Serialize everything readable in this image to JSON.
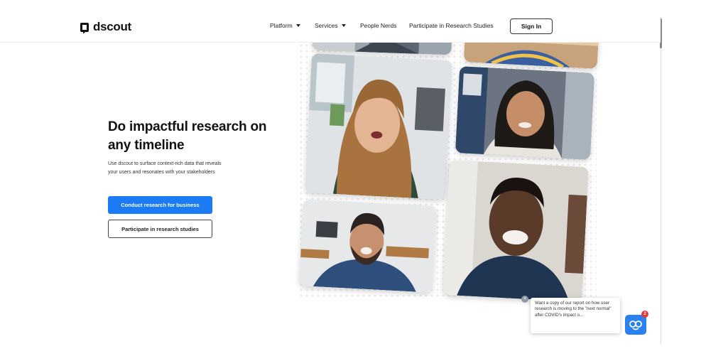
{
  "header": {
    "logo_text": "dscout",
    "nav": {
      "platform": "Platform",
      "services": "Services",
      "people_nerds": "People Nerds",
      "participate": "Participate in Research Studies"
    },
    "sign_in": "Sign In"
  },
  "hero": {
    "title": "Do impactful research on any timeline",
    "subtitle": "Use dscout to surface context-rich data that reveals your users and resonates with your stakeholders",
    "primary_button": "Conduct research for business",
    "secondary_button": "Participate in research studies"
  },
  "chat": {
    "message": "Want a copy of our report on how user research is moving to the \"next normal\" after COVID's impact o...",
    "badge_count": "2",
    "close_symbol": "×"
  },
  "colors": {
    "primary": "#1a7bf5",
    "chat_launcher": "#2a82f0",
    "badge": "#e53935"
  }
}
